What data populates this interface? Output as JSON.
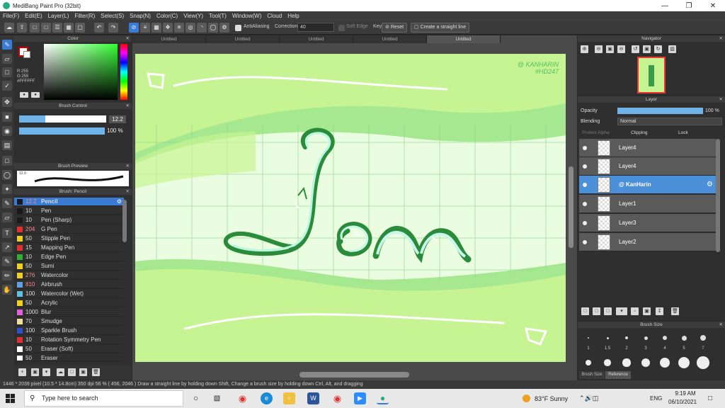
{
  "app": {
    "title": "MediBang Paint Pro (32bit)"
  },
  "menu": [
    "File(F)",
    "Edit(E)",
    "Layer(L)",
    "Filter(R)",
    "Select(S)",
    "Snap(N)",
    "Color(C)",
    "View(Y)",
    "Tool(T)",
    "Window(W)",
    "Cloud",
    "Help"
  ],
  "toolbar": {
    "antialias_label": "AntiAliasing",
    "correction_label": "Correction",
    "correction_value": "40",
    "soft_edge_label": "Soft Edge",
    "key_label": "Key",
    "reset_label": "Reset",
    "straight_line_label": "Create a straight line"
  },
  "color_panel": {
    "title": "Color",
    "r": "R:255",
    "g": "G:255",
    "hex": "#FFFFFF"
  },
  "brush_control": {
    "title": "Brush Control",
    "size": "12.2",
    "opacity": "100 %",
    "size_pct": 0.3,
    "opacity_pct": 1.0
  },
  "brush_preview": {
    "title": "Brush Preview",
    "label": "12.0"
  },
  "brush_list": {
    "title": "Brush: Pencil",
    "items": [
      {
        "size": "12.2",
        "name": "Pencil",
        "color": "#1a1a1a",
        "selected": true
      },
      {
        "size": "10",
        "name": "Pen",
        "color": "#1a1a1a"
      },
      {
        "size": "10",
        "name": "Pen (Sharp)",
        "color": "#1a1a1a"
      },
      {
        "size": "204",
        "name": "G Pen",
        "color": "#e03030"
      },
      {
        "size": "50",
        "name": "Stipple Pen",
        "color": "#f0d020"
      },
      {
        "size": "15",
        "name": "Mapping Pen",
        "color": "#e03030"
      },
      {
        "size": "10",
        "name": "Edge Pen",
        "color": "#30b030"
      },
      {
        "size": "50",
        "name": "Sumi",
        "color": "#f0d020"
      },
      {
        "size": "276",
        "name": "Watercolor",
        "color": "#f0d020"
      },
      {
        "size": "810",
        "name": "Airbrush",
        "color": "#60a0e0"
      },
      {
        "size": "100",
        "name": "Watercolor (Wet)",
        "color": "#60c0e0"
      },
      {
        "size": "50",
        "name": "Acrylic",
        "color": "#f0d020"
      },
      {
        "size": "1000",
        "name": "Blur",
        "color": "#e060e0"
      },
      {
        "size": "70",
        "name": "Smudge",
        "color": "#f0e0a0"
      },
      {
        "size": "100",
        "name": "Sparkle Brush",
        "color": "#3050d0"
      },
      {
        "size": "10",
        "name": "Rotation Symmetry Pen",
        "color": "#e03030"
      },
      {
        "size": "50",
        "name": "Eraser (Soft)",
        "color": "#ffffff"
      },
      {
        "size": "50",
        "name": "Eraser",
        "color": "#ffffff"
      }
    ]
  },
  "doc_tabs": [
    "Untitled",
    "Untitled",
    "Untitled",
    "Untitled",
    "Untitled"
  ],
  "canvas": {
    "watermark_line1": "@ KANHARIN",
    "watermark_line2": "#HD247",
    "lettering": "Jan"
  },
  "navigator": {
    "title": "Navigator"
  },
  "layer_panel": {
    "title": "Layer",
    "opacity_label": "Opacity",
    "opacity_value": "100 %",
    "blending_label": "Blending",
    "blending_value": "Normal",
    "protect_alpha": "Protect Alpha",
    "clipping": "Clipping",
    "lock": "Lock",
    "layers": [
      {
        "name": "Layer4",
        "selected": false
      },
      {
        "name": "Layer4",
        "selected": false
      },
      {
        "name": "@ KanHarin",
        "selected": true
      },
      {
        "name": "Layer1",
        "selected": false
      },
      {
        "name": "Layer3",
        "selected": false
      },
      {
        "name": "Layer2",
        "selected": false
      }
    ]
  },
  "brush_size": {
    "title": "Brush Size",
    "labels": [
      "1",
      "1.5",
      "2",
      "3",
      "4",
      "5",
      "7"
    ],
    "tab_size": "Brush Size",
    "tab_reference": "Reference"
  },
  "status": "1446 * 2039 pixel  (10.5 * 14.8cm)  350 dpi  56 %  ( 456, 2046 )  Draw a straight line by holding down Shift, Change a brush size by holding down Ctrl, Alt, and dragging",
  "taskbar": {
    "search_placeholder": "Type here to search",
    "weather": "83°F  Sunny",
    "lang": "ENG",
    "time": "9:19 AM",
    "date": "06/10/2021"
  }
}
